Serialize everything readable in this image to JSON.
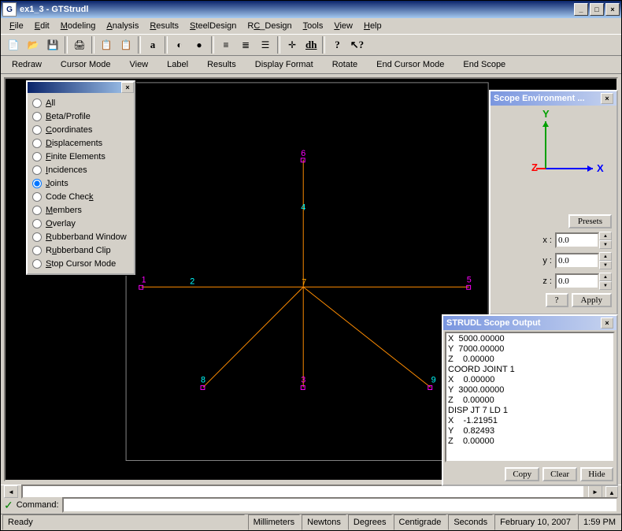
{
  "window": {
    "title": "ex1_3 - GTStrudl"
  },
  "menu": [
    "File",
    "Edit",
    "Modeling",
    "Analysis",
    "Results",
    "SteelDesign",
    "RC_Design",
    "Tools",
    "View",
    "Help"
  ],
  "menu_u": [
    "F",
    "E",
    "M",
    "A",
    "R",
    "S",
    "C",
    "T",
    "V",
    "H"
  ],
  "tb2": [
    "Redraw",
    "Cursor Mode",
    "View",
    "Label",
    "Results",
    "Display Format",
    "Rotate",
    "End Cursor Mode",
    "End Scope"
  ],
  "popup": {
    "options": [
      "All",
      "Beta/Profile",
      "Coordinates",
      "Displacements",
      "Finite Elements",
      "Incidences",
      "Joints",
      "Code Check",
      "Members",
      "Overlay",
      "Rubberband Window",
      "Rubberband Clip",
      "Stop Cursor Mode"
    ],
    "selected": 6
  },
  "scope_env": {
    "title": "Scope Environment ...",
    "presets": "Presets",
    "x": "0.0",
    "y": "0.0",
    "z": "0.0",
    "apply": "Apply",
    "help": "?"
  },
  "scope_out": {
    "title": "STRUDL Scope Output",
    "text": "X  5000.00000\nY  7000.00000\nZ    0.00000\nCOORD JOINT 1\nX    0.00000\nY  3000.00000\nZ    0.00000\nDISP JT 7 LD 1\nX    -1.21951\nY    0.82493\nZ    0.00000",
    "copy": "Copy",
    "clear": "Clear",
    "hide": "Hide"
  },
  "cmd": {
    "label": "Command:",
    "value": ""
  },
  "status": {
    "ready": "Ready",
    "units": [
      "Millimeters",
      "Newtons",
      "Degrees",
      "Centigrade",
      "Seconds"
    ],
    "date": "February 10, 2007",
    "time": "1:59 PM"
  },
  "nodes": {
    "1": "1",
    "2": "2",
    "3": "3",
    "4": "4",
    "5": "5",
    "6": "6",
    "7": "7",
    "8": "8",
    "9": "9"
  }
}
